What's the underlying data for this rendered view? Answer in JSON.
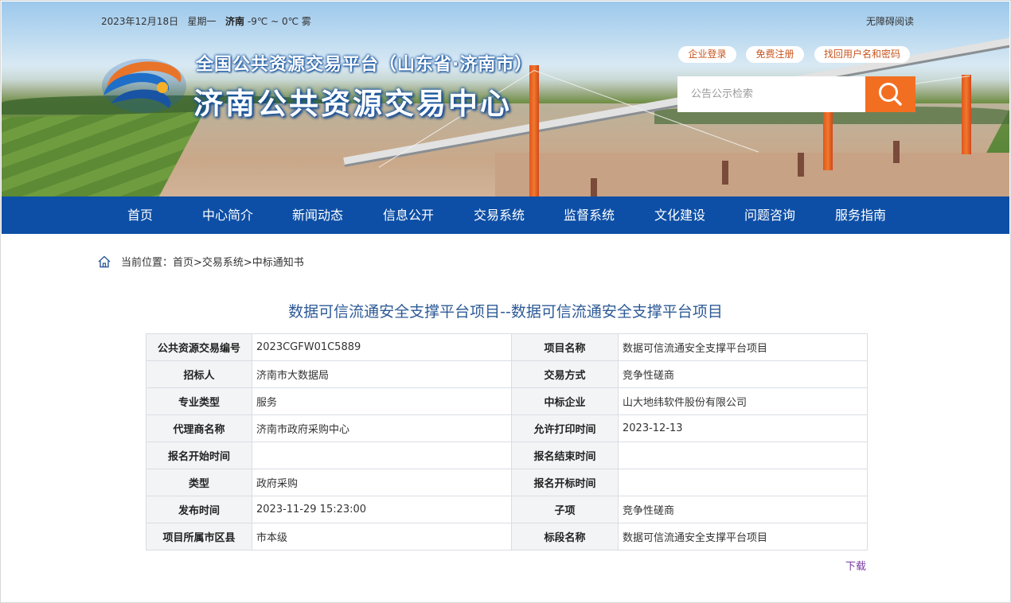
{
  "header": {
    "date": "2023年12月18日",
    "weekday": "星期一",
    "city": "济南",
    "weather": "-9℃ ~ 0℃ 雾",
    "accessibility_link": "无障碍阅读",
    "title_small": "全国公共资源交易平台（山东省·济南市）",
    "title_big": "济南公共资源交易中心",
    "links": {
      "login": "企业登录",
      "register": "免费注册",
      "recover": "找回用户名和密码"
    },
    "search_placeholder": "公告公示检索",
    "search_icon": "search-icon"
  },
  "nav": {
    "items": [
      "首页",
      "中心简介",
      "新闻动态",
      "信息公开",
      "交易系统",
      "监督系统",
      "文化建设",
      "问题咨询",
      "服务指南"
    ]
  },
  "breadcrumb": {
    "icon": "home-icon",
    "text": "当前位置：首页>交易系统>中标通知书"
  },
  "page": {
    "title": "数据可信流通安全支撑平台项目--数据可信流通安全支撑平台项目",
    "rows": [
      {
        "label1": "公共资源交易编号",
        "value1": "2023CGFW01C5889",
        "label2": "项目名称",
        "value2": "数据可信流通安全支撑平台项目"
      },
      {
        "label1": "招标人",
        "value1": "济南市大数据局",
        "label2": "交易方式",
        "value2": "竞争性磋商"
      },
      {
        "label1": "专业类型",
        "value1": "服务",
        "label2": "中标企业",
        "value2": "山大地纬软件股份有限公司"
      },
      {
        "label1": "代理商名称",
        "value1": "济南市政府采购中心",
        "label2": "允许打印时间",
        "value2": "2023-12-13"
      },
      {
        "label1": "报名开始时间",
        "value1": "",
        "label2": "报名结束时间",
        "value2": ""
      },
      {
        "label1": "类型",
        "value1": "政府采购",
        "label2": "报名开标时间",
        "value2": ""
      },
      {
        "label1": "发布时间",
        "value1": "2023-11-29 15:23:00",
        "label2": "子项",
        "value2": "竞争性磋商"
      },
      {
        "label1": "项目所属市区县",
        "value1": "市本级",
        "label2": "标段名称",
        "value2": "数据可信流通安全支撑平台项目"
      }
    ],
    "download_label": "下载"
  },
  "colors": {
    "nav_bg": "#0d4fa6",
    "accent_orange": "#f26f21",
    "title_blue": "#2d5a96",
    "download_purple": "#7a3aa0"
  }
}
